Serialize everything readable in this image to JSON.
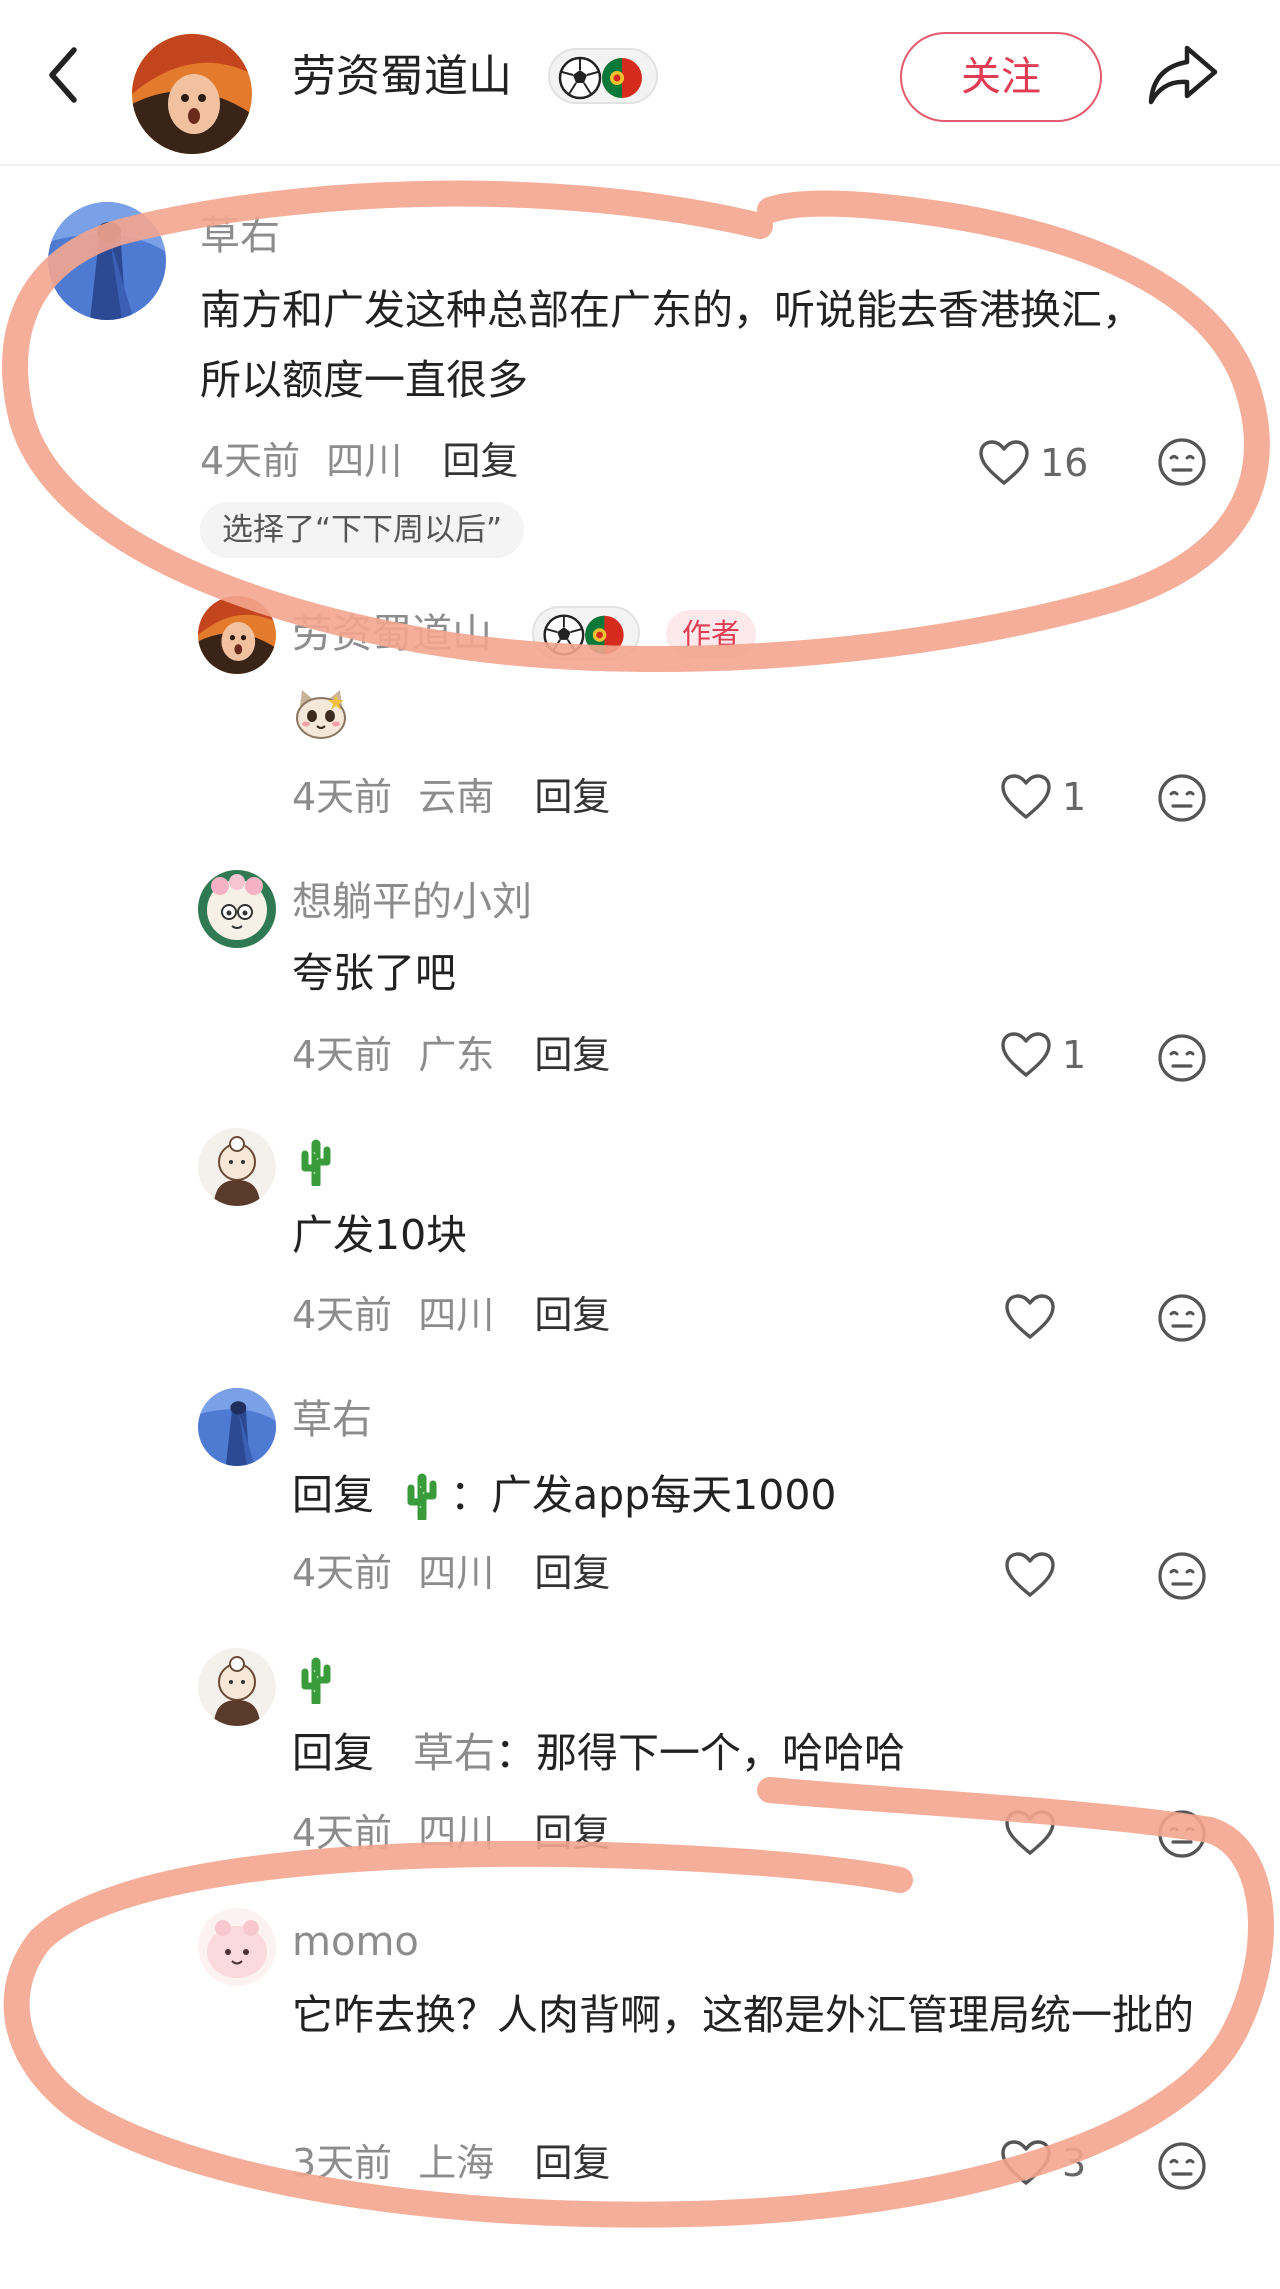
{
  "header": {
    "name": "劳资蜀道山",
    "follow_label": "关注",
    "icons": {
      "back": "back-arrow-icon",
      "share": "share-icon"
    }
  },
  "comments": [
    {
      "author": "草右",
      "content": "南方和广发这种总部在广东的，听说能去香港换汇，所以额度一直很多",
      "time": "4天前",
      "location": "四川",
      "reply_label": "回复",
      "likes": "16",
      "tag": "选择了“下下周以后”"
    },
    {
      "author": "劳资蜀道山",
      "author_badge": "作者",
      "content": "cat-sticker",
      "time": "4天前",
      "location": "云南",
      "reply_label": "回复",
      "likes": "1"
    },
    {
      "author": "想躺平的小刘",
      "content": "夸张了吧",
      "time": "4天前",
      "location": "广东",
      "reply_label": "回复",
      "likes": "1"
    },
    {
      "author": "🌵",
      "content": "广发10块",
      "time": "4天前",
      "location": "四川",
      "reply_label": "回复",
      "likes": ""
    },
    {
      "author": "草右",
      "content_prefix": "回复",
      "content_target": "🌵",
      "content": "：广发app每天1000",
      "time": "4天前",
      "location": "四川",
      "reply_label": "回复",
      "likes": ""
    },
    {
      "author": "🌵",
      "content_prefix": "回复",
      "content_target": "草右",
      "content": "：那得下一个，哈哈哈",
      "time": "4天前",
      "location": "四川",
      "reply_label": "回复",
      "likes": ""
    },
    {
      "author": "momo",
      "content": "它咋去换？人肉背啊，这都是外汇管理局统一批的",
      "time": "3天前",
      "location": "上海",
      "reply_label": "回复",
      "likes": "3"
    }
  ],
  "colors": {
    "accent": "#e03c54",
    "highlight": "#f4a58e",
    "meta": "#8c8c8c"
  }
}
